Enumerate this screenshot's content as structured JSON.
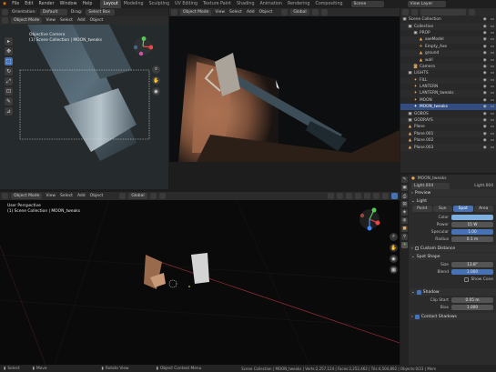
{
  "topbar": {
    "menus": [
      "File",
      "Edit",
      "Render",
      "Window",
      "Help"
    ],
    "workspaces": [
      "Layout",
      "Modeling",
      "Sculpting",
      "UV Editing",
      "Texture Paint",
      "Shading",
      "Animation",
      "Rendering",
      "Compositing"
    ],
    "active_workspace": "Layout",
    "scene": "Scene",
    "view_layer": "View Layer"
  },
  "toolheader": {
    "orientation_label": "Orientation:",
    "orientation_value": "Default",
    "drag_label": "Drag:",
    "drag_value": "Select Box"
  },
  "viewport_tl": {
    "mode": "Object Mode",
    "menu": [
      "View",
      "Select",
      "Add",
      "Object"
    ],
    "camera_label": "Objective Camera",
    "collection_label": "(1) Scene Collection | MOON_tweaks"
  },
  "viewport_tr": {
    "mode": "Object Mode",
    "menu": [
      "View",
      "Select",
      "Add",
      "Object"
    ],
    "transform": "Global"
  },
  "viewport_bottom": {
    "mode": "Object Mode",
    "menu": [
      "View",
      "Select",
      "Add",
      "Object"
    ],
    "transform": "Global",
    "perspective_label": "User Perspective",
    "collection_label": "(1) Scene Collection | MOON_tweaks"
  },
  "outliner": {
    "search_placeholder": "",
    "rows": [
      {
        "label": "Scene Collection",
        "indent": 0,
        "icon": "collection-icon",
        "color": "#cccccc",
        "sel": false
      },
      {
        "label": "Collection",
        "indent": 1,
        "icon": "collection-icon",
        "color": "#cccccc",
        "sel": false
      },
      {
        "label": "PROP",
        "indent": 2,
        "icon": "collection-icon",
        "color": "#cccccc",
        "sel": false
      },
      {
        "label": "axeModel",
        "indent": 3,
        "icon": "mesh-icon",
        "color": "#e8a85a",
        "sel": false
      },
      {
        "label": "Empty_Axe",
        "indent": 3,
        "icon": "empty-icon",
        "color": "#e8a85a",
        "sel": false
      },
      {
        "label": "ground",
        "indent": 3,
        "icon": "mesh-icon",
        "color": "#e8a85a",
        "sel": false
      },
      {
        "label": "wall",
        "indent": 3,
        "icon": "mesh-icon",
        "color": "#e8a85a",
        "sel": false
      },
      {
        "label": "Camera",
        "indent": 2,
        "icon": "camera-icon",
        "color": "#e8a85a",
        "sel": false
      },
      {
        "label": "LIGHTS",
        "indent": 1,
        "icon": "collection-icon",
        "color": "#cccccc",
        "sel": false
      },
      {
        "label": "FILL",
        "indent": 2,
        "icon": "light-icon",
        "color": "#e8a85a",
        "sel": false
      },
      {
        "label": "LANTERN",
        "indent": 2,
        "icon": "light-icon",
        "color": "#e8a85a",
        "sel": false
      },
      {
        "label": "LANTERN_tweaks",
        "indent": 2,
        "icon": "light-icon",
        "color": "#e8a85a",
        "sel": false
      },
      {
        "label": "MOON",
        "indent": 2,
        "icon": "light-icon",
        "color": "#e8a85a",
        "sel": false
      },
      {
        "label": "MOON_tweaks",
        "indent": 2,
        "icon": "light-icon",
        "color": "#ffffff",
        "sel": true
      },
      {
        "label": "GOBOS",
        "indent": 1,
        "icon": "collection-icon",
        "color": "#cccccc",
        "sel": false
      },
      {
        "label": "GODRAYS",
        "indent": 1,
        "icon": "collection-icon",
        "color": "#cccccc",
        "sel": false
      },
      {
        "label": "Plane",
        "indent": 1,
        "icon": "mesh-icon",
        "color": "#e8a85a",
        "sel": false
      },
      {
        "label": "Plane.001",
        "indent": 1,
        "icon": "mesh-icon",
        "color": "#e8a85a",
        "sel": false
      },
      {
        "label": "Plane.002",
        "indent": 1,
        "icon": "mesh-icon",
        "color": "#e8a85a",
        "sel": false
      },
      {
        "label": "Plane.003",
        "indent": 1,
        "icon": "mesh-icon",
        "color": "#e8a85a",
        "sel": false
      }
    ]
  },
  "properties": {
    "breadcrumb": "MOON_tweaks",
    "data_name": "Light.004",
    "data_name_right": "Light.004",
    "sections": {
      "preview": "Preview",
      "light": "Light",
      "custom_distance": "Custom Distance",
      "spot_shape": "Spot Shape",
      "shadow": "Shadow",
      "contact_shadows": "Contact Shadows"
    },
    "light_types": [
      "Point",
      "Sun",
      "Spot",
      "Area"
    ],
    "active_light_type": "Spot",
    "fields": {
      "color_label": "Color",
      "power_label": "Power",
      "power_value": "15 W",
      "specular_label": "Specular",
      "specular_value": "1.00",
      "radius_label": "Radius",
      "radius_value": "0.1 m",
      "size_label": "Size",
      "size_value": "13.8°",
      "blend_label": "Blend",
      "blend_value": "1.000",
      "show_cone_label": "Show Cone",
      "clip_start_label": "Clip Start",
      "clip_start_value": "0.05 m",
      "bias_label": "Bias",
      "bias_value": "1.000"
    },
    "color_swatch": "#7fb1e0"
  },
  "statusbar": {
    "select": "Select",
    "move": "Move",
    "rotate": "Rotate View",
    "context": "Object Context Menu",
    "stats": "Scene Collection | MOON_tweaks | Verts:2,257,124 | Faces:2,252,462 | Tris:4,504,892 | Objects:0/23 | Mem"
  },
  "colors": {
    "accent": "#4772b3",
    "selection": "#334d80",
    "wall": "#b07a5c",
    "active_tool": "#4772b3"
  }
}
